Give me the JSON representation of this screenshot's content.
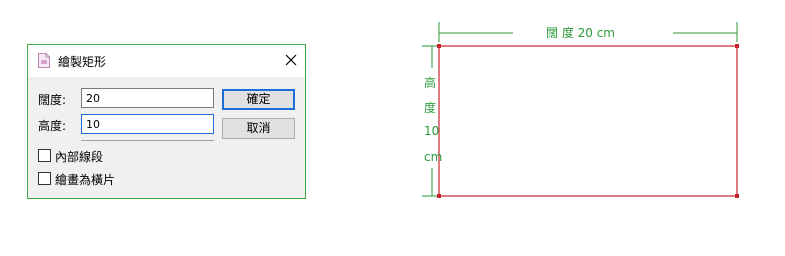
{
  "dialog": {
    "title": "繪製矩形",
    "width_label": "闊度:",
    "width_value": "20",
    "height_label": "高度:",
    "height_value": "10",
    "ok_label": "確定",
    "cancel_label": "取消",
    "inner_lines_label": "內部線段",
    "draw_as_slice_label": "繪畫為橫片",
    "inner_lines_checked": false,
    "draw_as_slice_checked": false
  },
  "drawing": {
    "width_dim_text": "闊 度 20 cm",
    "height_dim_chars": [
      "高",
      "度",
      "10",
      "cm"
    ],
    "rect_color": "#c8232c",
    "dim_color": "#2c9a3a"
  }
}
